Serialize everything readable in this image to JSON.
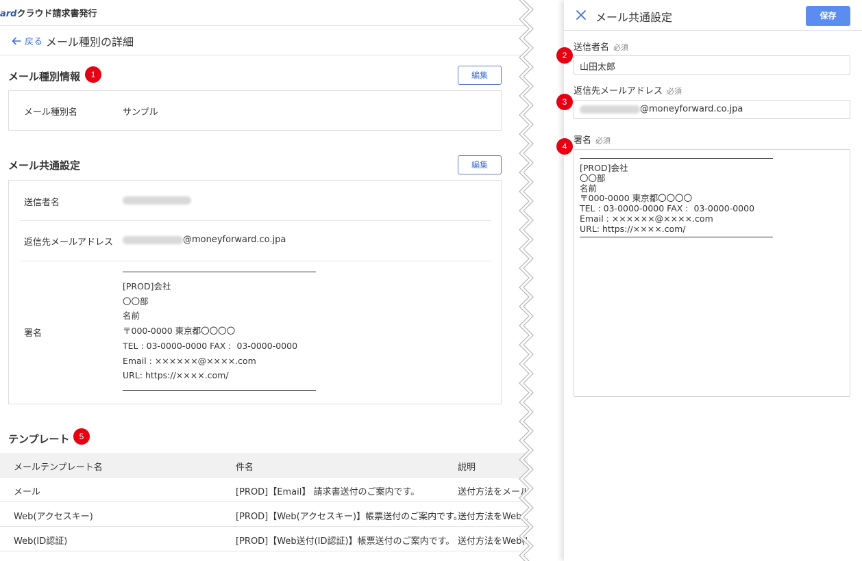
{
  "app": {
    "brand_prefix": "ard",
    "brand_name": "クラウド請求書発行"
  },
  "nav": {
    "back_label": "戻る",
    "page_title": "メール種別の詳細"
  },
  "badges": {
    "b1": "1",
    "b2": "2",
    "b3": "3",
    "b4": "4",
    "b5": "5"
  },
  "mail_type_info": {
    "title": "メール種別情報",
    "edit_label": "編集",
    "name_label": "メール種別名",
    "name_value": "サンプル"
  },
  "mail_common": {
    "title": "メール共通設定",
    "edit_label": "編集",
    "sender_label": "送信者名",
    "reply_label": "返信先メールアドレス",
    "reply_domain": "@moneyforward.co.jpa",
    "signature_label": "署名",
    "signature_text": "[PROD]会社\n〇〇部\n名前\n〒000-0000 東京都〇〇〇〇\nTEL : 03-0000-0000 FAX :  03-0000-0000\nEmail : ××××××@××××.com\nURL: https://××××.com/"
  },
  "templates": {
    "title": "テンプレート",
    "columns": [
      "メールテンプレート名",
      "件名",
      "説明"
    ],
    "rows": [
      {
        "name": "メール",
        "subject": "[PROD]【Email】 請求書送付のご案内です。",
        "desc": "送付方法をメール"
      },
      {
        "name": "Web(アクセスキー)",
        "subject": "[PROD]【Web(アクセスキー)】帳票送付のご案内です。",
        "desc": "送付方法をWeb(ア"
      },
      {
        "name": "Web(ID認証)",
        "subject": "[PROD]【Web送付(ID認証)】帳票送付のご案内です。",
        "desc": "送付方法をWeb(I"
      }
    ]
  },
  "panel": {
    "title": "メール共通設定",
    "save_label": "保存",
    "sender_label": "送信者名",
    "required": "必須",
    "sender_value": "山田太郎",
    "reply_label": "返信先メールアドレス",
    "reply_domain": "@moneyforward.co.jpa",
    "signature_label": "署名",
    "signature_text": "[PROD]会社\n〇〇部\n名前\n〒000-0000 東京都〇〇〇〇\nTEL : 03-0000-0000 FAX :  03-0000-0000\nEmail : ××××××@××××.com\nURL: https://××××.com/"
  },
  "colors": {
    "accent": "#3f6fd8",
    "save": "#5b8df0",
    "badge": "#e60012"
  }
}
